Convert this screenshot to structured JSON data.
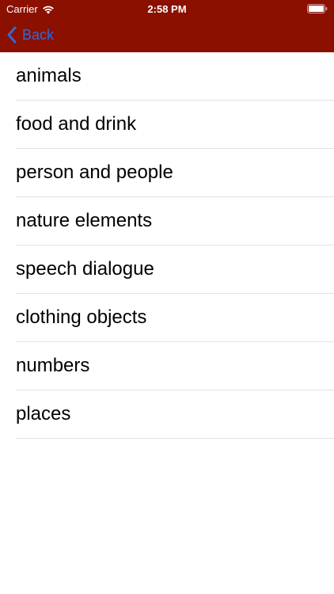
{
  "status_bar": {
    "carrier": "Carrier",
    "time": "2:58 PM",
    "wifi_icon": "wifi-icon",
    "battery_icon": "battery-icon"
  },
  "nav": {
    "back_label": "Back",
    "back_icon": "chevron-left-icon"
  },
  "colors": {
    "header_bg": "#8b1000",
    "back_accent": "#2f6bd6",
    "separator": "#e3e3e6"
  },
  "categories": [
    {
      "label": "animals"
    },
    {
      "label": "food and drink"
    },
    {
      "label": "person and people"
    },
    {
      "label": "nature elements"
    },
    {
      "label": "speech dialogue"
    },
    {
      "label": "clothing objects"
    },
    {
      "label": "numbers"
    },
    {
      "label": "places"
    }
  ]
}
